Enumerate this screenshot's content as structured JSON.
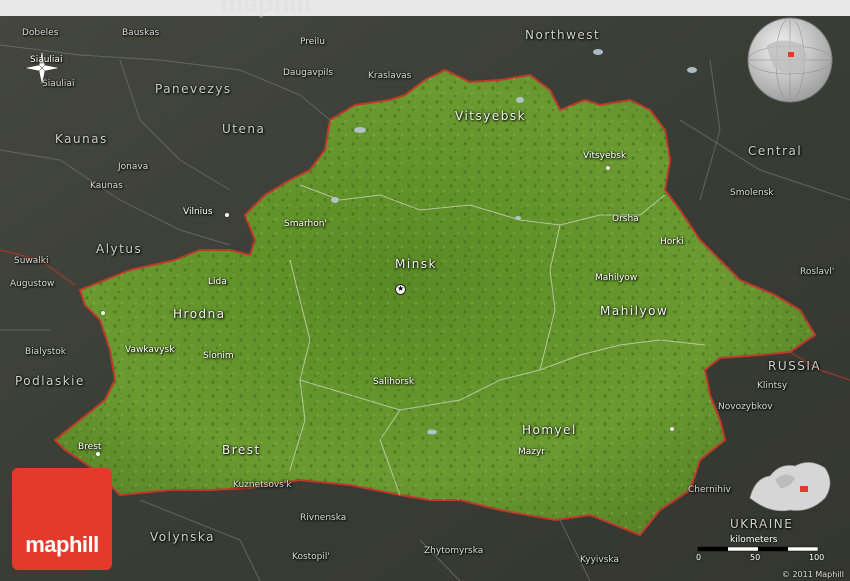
{
  "branding": {
    "logo": "maphill",
    "top_watermark": "maphill",
    "copyright": "© 2011 Maphill"
  },
  "scale": {
    "label": "kilometers",
    "ticks": [
      "0",
      "50",
      "100"
    ]
  },
  "icons": [
    "compass-rose-icon",
    "globe-locator-icon",
    "europe-locator-icon",
    "capital-star-icon"
  ],
  "colors": {
    "country_fill": "#5e8a2a",
    "border": "#c0392b",
    "surround": "#3a3d36",
    "logo_bg": "#e33a2c"
  },
  "regions_belarus": {
    "vitsyebsk": "Vitsyebsk",
    "minsk": "Minsk",
    "hrodna": "Hrodna",
    "mahilyow": "Mahilyow",
    "brest": "Brest",
    "homyel": "Homyel"
  },
  "regions_neighbors": {
    "panevezys": "Panevezys",
    "utena": "Utena",
    "kaunas": "Kaunas",
    "alytus": "Alytus",
    "northwest": "Northwest",
    "central": "Central",
    "podlaskie": "Podlaskie",
    "volynska": "Volynska",
    "russia": "RUSSIA",
    "ukraine": "UKRAINE"
  },
  "cities": {
    "siauliai_top": "Siauliai",
    "siauliai": "Siauliai",
    "dobeles": "Dobeles",
    "bauskas": "Bauskas",
    "preilu": "Preilu",
    "daugavpils": "Daugavpils",
    "kraslavas": "Kraslavas",
    "jonava": "Jonava",
    "kaunas_city": "Kaunas",
    "vilnius": "Vilnius",
    "suwalki": "Suwalki",
    "augustow": "Augustow",
    "bialystok": "Bialystok",
    "vitsyebsk_city": "Vitsyebsk",
    "smolensk": "Smolensk",
    "orsha": "Orsha",
    "horki": "Horki",
    "roslavl": "Roslavl'",
    "smarhon": "Smarhon'",
    "lida": "Lida",
    "mahilyow_city": "Mahilyow",
    "vawkavysk": "Vawkavysk",
    "slonim": "Slonim",
    "salihorsk": "Salihorsk",
    "klintsy": "Klintsy",
    "novozybkov": "Novozybkov",
    "brest_city": "Brest",
    "mazyr": "Mazyr",
    "kuznetsovsk": "Kuznetsovs'k",
    "rivnenska": "Rivnenska",
    "chernihiv": "Chernihiv",
    "kostopil": "Kostopil'",
    "zhytomyrska": "Zhytomyrska",
    "kyyivska": "Kyyivska"
  }
}
